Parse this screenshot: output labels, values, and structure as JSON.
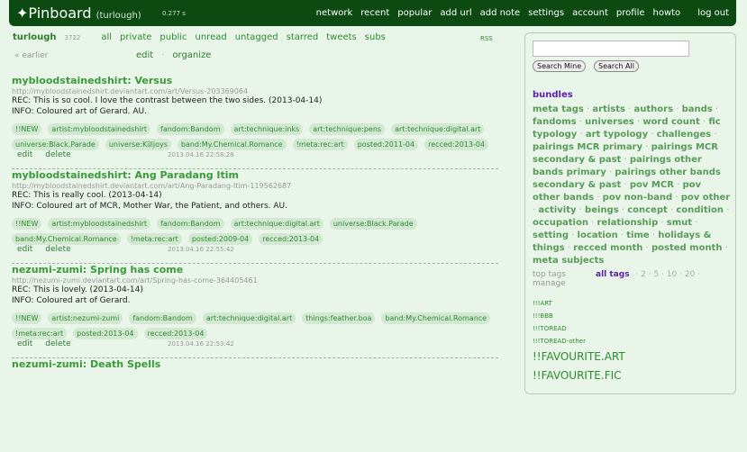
{
  "header": {
    "logo": "Pinboard",
    "user": "(turlough)",
    "timing": "0.277 s",
    "nav": [
      "network",
      "recent",
      "popular",
      "add url",
      "add note",
      "settings",
      "account",
      "profile",
      "howto"
    ],
    "logout": "log out"
  },
  "subnav": {
    "user": "turlough",
    "count": "3722",
    "links": [
      "all",
      "private",
      "public",
      "unread",
      "untagged",
      "starred",
      "tweets",
      "subs"
    ],
    "rss": "RSS"
  },
  "paging": {
    "earlier": "« earlier",
    "edit": "edit",
    "sep": "·",
    "organize": "organize"
  },
  "bookmarks": [
    {
      "title": "mybloodstainedshirt: Versus",
      "url": "http://mybloodstainedshirt.deviantart.com/art/Versus-203369064",
      "rec": "REC: This is so cool. I love the contrast between the two sides. (2013-04-14)",
      "info": "INFO: Coloured art of Gerard. AU.",
      "tags": [
        "!!NEW",
        "artist:mybloodstainedshirt",
        "fandom:Bandom",
        "art:technique:inks",
        "art:technique:pens",
        "art:technique:digital.art",
        "universe:Black.Parade",
        "universe:Killjoys",
        "band:My.Chemical.Romance",
        "!meta:rec:art",
        "posted:2011-04",
        "recced:2013-04"
      ],
      "date": "2013.04.16  22:58:28"
    },
    {
      "title": "mybloodstainedshirt: Ang Paradang Itim",
      "url": "http://mybloodstainedshirt.deviantart.com/art/Ang-Paradang-Itim-119562687",
      "rec": "REC: This is really cool. (2013-04-14)",
      "info": "INFO: Coloured art of MCR, Mother War, the Patient, and others. AU.",
      "tags": [
        "!!NEW",
        "artist:mybloodstainedshirt",
        "fandom:Bandom",
        "art:technique:digital.art",
        "universe:Black.Parade",
        "band:My.Chemical.Romance",
        "!meta:rec:art",
        "posted:2009-04",
        "recced:2013-04"
      ],
      "date": "2013.04.16  22:55:42"
    },
    {
      "title": "nezumi-zumi: Spring has come",
      "url": "http://nezumi-zumi.deviantart.com/art/Spring-has-come-364405461",
      "rec": "REC: This is lovely. (2013-04-14)",
      "info": "INFO: Coloured art of Gerard.",
      "tags": [
        "!!NEW",
        "artist:nezumi-zumi",
        "fandom:Bandom",
        "art:technique:digital.art",
        "things:feather.boa",
        "band:My.Chemical.Romance",
        "!meta:rec:art",
        "posted:2013-04",
        "recced:2013-04"
      ],
      "date": "2013.04.16  22:53:42"
    },
    {
      "title": "nezumi-zumi: Death Spells"
    }
  ],
  "actions": {
    "edit": "edit",
    "delete": "delete"
  },
  "sidebar": {
    "search_value": "",
    "search_mine": "Search Mine",
    "search_all": "Search All",
    "bundles_title": "bundles",
    "bundles": [
      "meta tags",
      "artists",
      "authors",
      "bands",
      "fandoms",
      "universes",
      "word count",
      "fic typology",
      "art typology",
      "challenges",
      "pairings MCR primary",
      "pairings MCR secondary & past",
      "pairings other bands primary",
      "pairings other bands secondary & past",
      "pov MCR",
      "pov other bands",
      "pov non-band",
      "pov other",
      "activity",
      "beings",
      "concept",
      "condition",
      "occupation",
      "relationship",
      "smut",
      "setting",
      "location",
      "time",
      "holidays & things",
      "recced month",
      "posted month",
      "meta subjects"
    ],
    "top_tags": "top tags",
    "manage": "manage",
    "all_tags": "all tags",
    "counts": [
      "2",
      "5",
      "10",
      "20"
    ],
    "small_tags": [
      "!!!ART",
      "!!!BBB",
      "!!!TOREAD",
      "!!!TOREAD-other"
    ],
    "big_tags": [
      "!!FAVOURITE.ART",
      "!!FAVOURITE.FIC"
    ]
  }
}
